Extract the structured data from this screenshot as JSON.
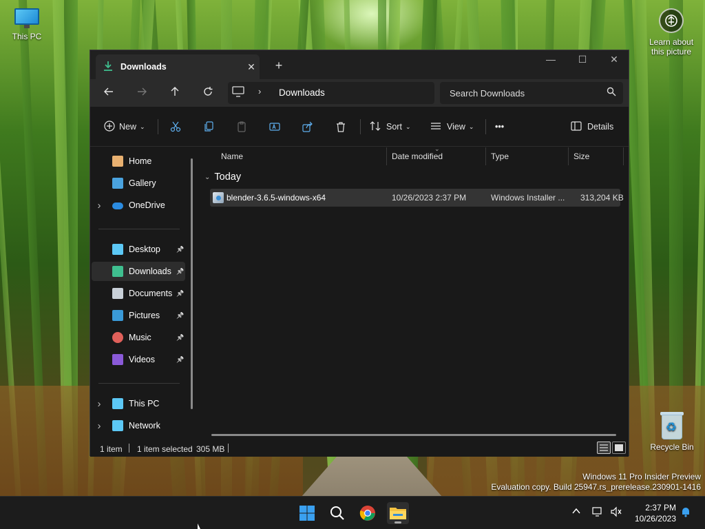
{
  "desktop": {
    "icons": {
      "this_pc": "This PC",
      "learn": "Learn about this picture",
      "recycle_bin": "Recycle Bin"
    },
    "watermark": {
      "line1": "Windows 11 Pro Insider Preview",
      "line2": "Evaluation copy. Build 25947.rs_prerelease.230901-1416"
    }
  },
  "window": {
    "tab_title": "Downloads",
    "caption": {
      "minimize": "—",
      "maximize": "☐",
      "close": "✕"
    },
    "address": {
      "location": "Downloads"
    },
    "search": {
      "placeholder": "Search Downloads"
    },
    "toolbar": {
      "new": "New",
      "sort": "Sort",
      "view": "View",
      "more": "•••",
      "details": "Details"
    },
    "sidebar": {
      "items": [
        {
          "label": "Home",
          "icon": "home-icon",
          "expandable": false,
          "pinned": false,
          "color": "#e8b070"
        },
        {
          "label": "Gallery",
          "icon": "gallery-icon",
          "expandable": false,
          "pinned": false,
          "color": "#4aa3df"
        },
        {
          "label": "OneDrive",
          "icon": "onedrive-icon",
          "expandable": true,
          "pinned": false,
          "color": "#2b8be0"
        },
        {
          "label": "Desktop",
          "icon": "desktop-icon",
          "expandable": false,
          "pinned": true,
          "color": "#5cc8f5"
        },
        {
          "label": "Downloads",
          "icon": "downloads-icon",
          "expandable": false,
          "pinned": true,
          "selected": true,
          "color": "#3fbf8f"
        },
        {
          "label": "Documents",
          "icon": "documents-icon",
          "expandable": false,
          "pinned": true,
          "color": "#c8d0d8"
        },
        {
          "label": "Pictures",
          "icon": "pictures-icon",
          "expandable": false,
          "pinned": true,
          "color": "#3a9ad8"
        },
        {
          "label": "Music",
          "icon": "music-icon",
          "expandable": false,
          "pinned": true,
          "color": "#e0605a"
        },
        {
          "label": "Videos",
          "icon": "videos-icon",
          "expandable": false,
          "pinned": true,
          "color": "#8a5ad8"
        },
        {
          "label": "This PC",
          "icon": "this-pc-icon",
          "expandable": true,
          "pinned": false,
          "color": "#5cc8f5"
        },
        {
          "label": "Network",
          "icon": "network-icon",
          "expandable": true,
          "pinned": false,
          "color": "#5cc8f5"
        }
      ]
    },
    "columns": {
      "name": "Name",
      "date": "Date modified",
      "type": "Type",
      "size": "Size"
    },
    "group": "Today",
    "files": [
      {
        "name": "blender-3.6.5-windows-x64",
        "date": "10/26/2023 2:37 PM",
        "type": "Windows Installer ...",
        "size": "313,204 KB"
      }
    ],
    "status": {
      "count": "1 item",
      "selected": "1 item selected",
      "size": "305 MB"
    }
  },
  "taskbar": {
    "clock": {
      "time": "2:37 PM",
      "date": "10/26/2023"
    }
  }
}
